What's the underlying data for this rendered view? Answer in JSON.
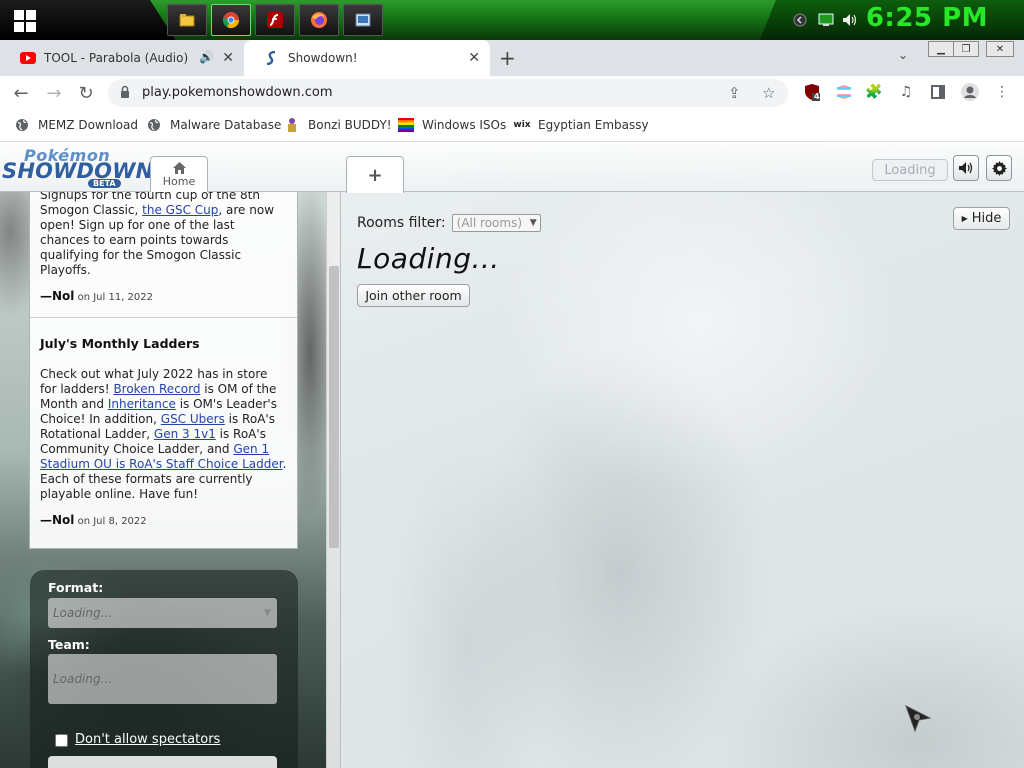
{
  "taskbar": {
    "clock": "6:25 PM",
    "apps": [
      "file-explorer",
      "chrome",
      "flash-player",
      "firefox",
      "media-player"
    ],
    "tray": [
      "back-tray-icon",
      "network-monitor-icon",
      "volume-icon"
    ],
    "accent_color": "#27e827"
  },
  "browser": {
    "tabs": [
      {
        "title": "TOOL - Parabola (Audio) - Yo",
        "favicon": "youtube-icon",
        "active": false
      },
      {
        "title": "Showdown!",
        "favicon": "showdown-icon",
        "active": true
      }
    ],
    "url": "play.pokemonshowdown.com",
    "bookmarks": [
      {
        "label": "MEMZ Download",
        "icon": "globe-icon"
      },
      {
        "label": "Malware Database",
        "icon": "globe-icon"
      },
      {
        "label": "Bonzi BUDDY!",
        "icon": "bonzi-icon"
      },
      {
        "label": "Windows ISOs",
        "icon": "rainbow-flag-icon"
      },
      {
        "label": "Egyptian Embassy",
        "icon": "wix-icon"
      }
    ],
    "extension_badge": "4"
  },
  "showdown": {
    "logo": {
      "line1": "Pokémon",
      "line2": "SHOWDOWN",
      "badge": "BETA"
    },
    "home_tab": "Home",
    "plus_tab": "+",
    "loading_button": "Loading",
    "news": {
      "item1": {
        "text_before": "Signups for the fourth cup of the 8th Smogon Classic, ",
        "link": "the GSC Cup",
        "text_after": ", are now open! Sign up for one of the last chances to earn points towards qualifying for the Smogon Classic Playoffs.",
        "author": "—Nol",
        "date": "on Jul 11, 2022"
      },
      "item2": {
        "title": "July's Monthly Ladders",
        "t1": "Check out what July 2022 has in store for ladders! ",
        "l1": "Broken Record",
        "t2": " is OM of the Month and ",
        "l2": "Inheritance",
        "t3": " is OM's Leader's Choice! In addition, ",
        "l3": "GSC Ubers",
        "t4": " is RoA's Rotational Ladder, ",
        "l4": "Gen 3 1v1",
        "t5": " is RoA's Community Choice Ladder, and ",
        "l5": "Gen 1 Stadium OU is RoA's Staff Choice Ladder",
        "t6": ". Each of these formats are currently playable online. Have fun!",
        "author": "—Nol",
        "date": "on Jul 8, 2022"
      }
    },
    "form": {
      "format_label": "Format:",
      "format_value": "Loading...",
      "team_label": "Team:",
      "team_value": "Loading...",
      "spectators_label": "Don't allow spectators"
    },
    "rooms": {
      "filter_label": "Rooms filter:",
      "filter_value": "(All rooms)",
      "hide_button": "Hide",
      "loading_text": "Loading...",
      "join_button": "Join other room"
    }
  }
}
